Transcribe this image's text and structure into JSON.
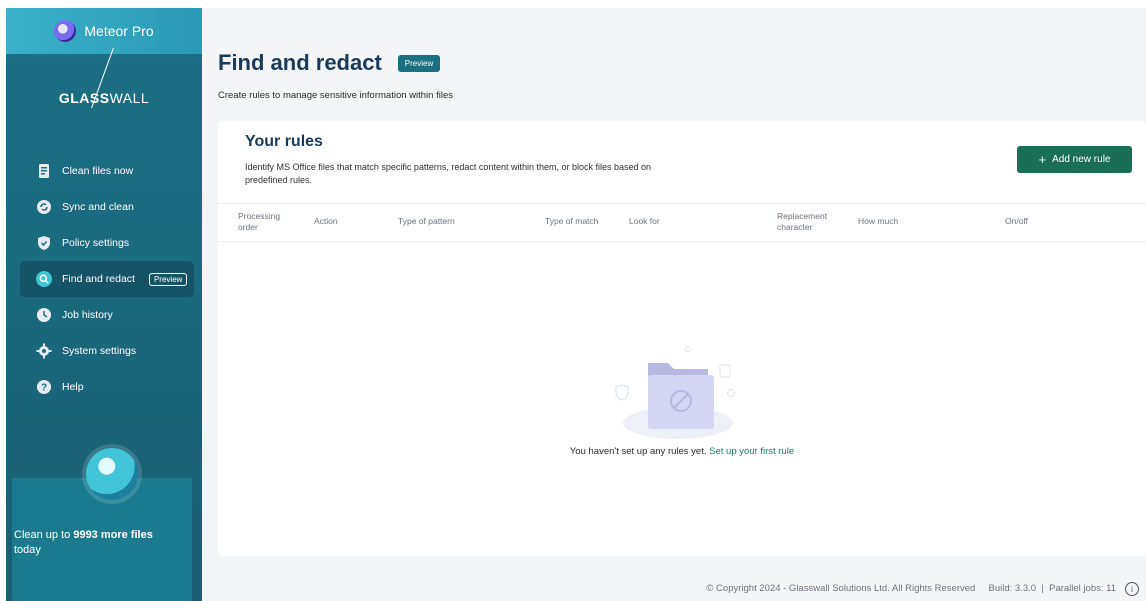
{
  "app": {
    "name": "Meteor Pro",
    "company_bold": "GLASS",
    "company_light": "WALL"
  },
  "sidebar": {
    "items": [
      {
        "label": "Clean files now",
        "icon": "document-icon"
      },
      {
        "label": "Sync and clean",
        "icon": "sync-icon"
      },
      {
        "label": "Policy settings",
        "icon": "shield-icon"
      },
      {
        "label": "Find and redact",
        "icon": "search-icon",
        "badge": "Preview",
        "active": true
      },
      {
        "label": "Job history",
        "icon": "clock-icon"
      },
      {
        "label": "System settings",
        "icon": "gear-icon"
      },
      {
        "label": "Help",
        "icon": "help-icon"
      }
    ],
    "promo": {
      "prefix": "Clean up to ",
      "count": "9993 more files",
      "suffix": "today"
    }
  },
  "page": {
    "title": "Find and redact",
    "badge": "Preview",
    "subtitle": "Create rules to manage sensitive information within files"
  },
  "rules": {
    "title": "Your rules",
    "description": "Identify MS Office files that match specific patterns, redact content within them, or block files based on predefined rules.",
    "add_button": "Add new rule",
    "columns": [
      "Processing order",
      "Action",
      "Type of pattern",
      "Type of match",
      "Look for",
      "Replacement character",
      "How much",
      "On/off"
    ],
    "empty_text": "You haven't set up any rules yet.",
    "empty_link": "Set up your first rule"
  },
  "footer": {
    "copyright": "© Copyright 2024 - Glasswall Solutions Ltd. All Rights Reserved",
    "build": "Build: 3.3.0",
    "parallel_jobs": "Parallel jobs: 11"
  },
  "colors": {
    "accent": "#1a6e55",
    "sidebar": "#1d6e86",
    "title": "#1b3a5b"
  }
}
